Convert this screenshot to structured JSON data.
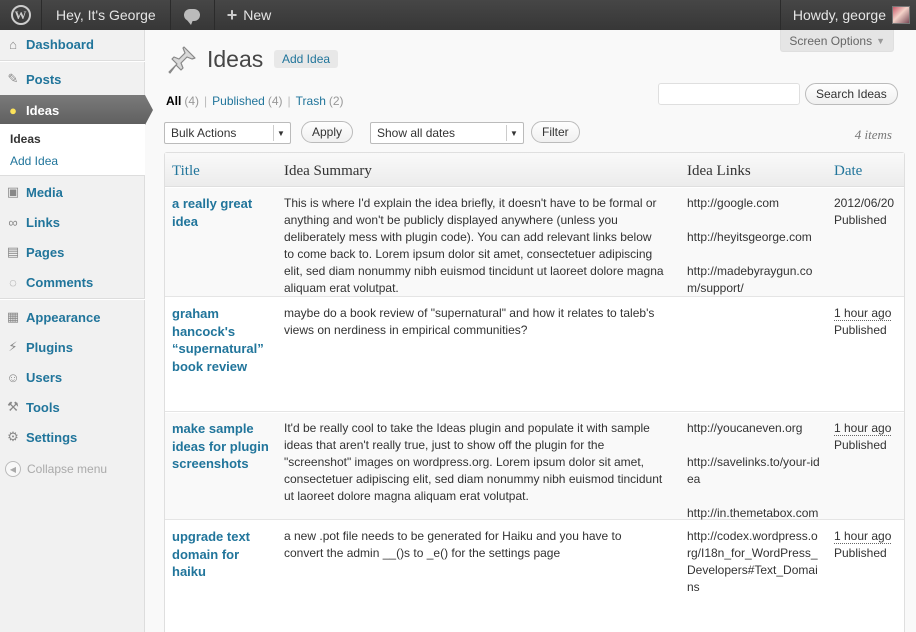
{
  "admin_bar": {
    "site_name": "Hey, It's George",
    "new_label": "New",
    "greeting": "Howdy, george"
  },
  "sidebar": {
    "items": [
      {
        "label": "Dashboard",
        "icon": "dashboard-icon"
      },
      {
        "label": "Posts",
        "icon": "pushpin-icon"
      },
      {
        "label": "Ideas",
        "icon": "lightbulb-icon"
      },
      {
        "label": "Media",
        "icon": "media-icon"
      },
      {
        "label": "Links",
        "icon": "link-icon"
      },
      {
        "label": "Pages",
        "icon": "pages-icon"
      },
      {
        "label": "Comments",
        "icon": "comment-icon"
      },
      {
        "label": "Appearance",
        "icon": "appearance-icon"
      },
      {
        "label": "Plugins",
        "icon": "plugin-icon"
      },
      {
        "label": "Users",
        "icon": "users-icon"
      },
      {
        "label": "Tools",
        "icon": "tools-icon"
      },
      {
        "label": "Settings",
        "icon": "settings-icon"
      }
    ],
    "submenu": [
      "Ideas",
      "Add Idea"
    ],
    "collapse_label": "Collapse menu"
  },
  "header": {
    "screen_options": "Screen Options",
    "title": "Ideas",
    "add_new": "Add Idea"
  },
  "filters": {
    "views": [
      {
        "label": "All",
        "count": "(4)"
      },
      {
        "label": "Published",
        "count": "(4)"
      },
      {
        "label": "Trash",
        "count": "(2)"
      }
    ],
    "search_button": "Search Ideas",
    "bulk_actions": "Bulk Actions",
    "apply": "Apply",
    "dates": "Show all dates",
    "filter": "Filter",
    "items_count": "4 items"
  },
  "table": {
    "columns": [
      "Title",
      "Idea Summary",
      "Idea Links",
      "Date"
    ],
    "rows": [
      {
        "title": "a really great idea",
        "summary": "This is where I'd explain the idea briefly, it doesn't have to be formal or anything and won't be publicly displayed anywhere (unless you deliberately mess with plugin code). You can add relevant links below to come back to. Lorem ipsum dolor sit amet, consectetuer adipiscing elit, sed diam nonummy nibh euismod tincidunt ut laoreet dolore magna aliquam erat volutpat.",
        "links": [
          "http://google.com",
          "http://heyitsgeorge.com",
          "http://madebyraygun.com/support/"
        ],
        "date": "2012/06/20",
        "status": "Published"
      },
      {
        "title": "graham hancock's “supernatural” book review",
        "summary": "maybe do a book review of \"supernatural\" and how it relates to taleb's views on nerdiness in empirical communities?",
        "links": [],
        "date": "1 hour ago",
        "status": "Published"
      },
      {
        "title": "make sample ideas for plugin screenshots",
        "summary": "It'd be really cool to take the Ideas plugin and populate it with sample ideas that aren't really true, just to show off the plugin for the \"screenshot\" images on wordpress.org. Lorem ipsum dolor sit amet, consectetuer adipiscing elit, sed diam nonummy nibh euismod tincidunt ut laoreet dolore magna aliquam erat volutpat.",
        "links": [
          "http://youcaneven.org",
          "http://savelinks.to/your-idea",
          "http://in.themetabox.com"
        ],
        "date": "1 hour ago",
        "status": "Published"
      },
      {
        "title": "upgrade text domain for haiku",
        "summary": "a new .pot file needs to be generated for Haiku and you have to convert the admin __()s to _e() for the settings page",
        "links": [
          "http://codex.wordpress.org/I18n_for_WordPress_Developers#Text_Domains"
        ],
        "date": "1 hour ago",
        "status": "Published"
      }
    ]
  }
}
